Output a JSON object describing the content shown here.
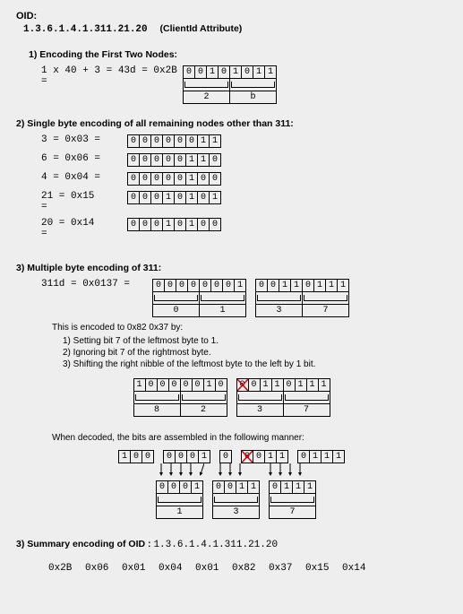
{
  "title": "OID:",
  "oid_value": "1.3.6.1.4.1.311.21.20",
  "oid_attr": "(ClientId Attribute)",
  "s1": {
    "heading": "1) Encoding the First Two Nodes:",
    "expr": "1 x 40 + 3 = 43d = 0x2B =",
    "bits": [
      "0",
      "0",
      "1",
      "0",
      "1",
      "0",
      "1",
      "1"
    ],
    "nibble_labels": [
      "2",
      "b"
    ]
  },
  "s2": {
    "heading": "2) Single byte encoding of all remaining nodes other than 311:",
    "rows": [
      {
        "lhs": "3  = 0x03 =",
        "bits": [
          "0",
          "0",
          "0",
          "0",
          "0",
          "0",
          "1",
          "1"
        ]
      },
      {
        "lhs": "6  = 0x06 =",
        "bits": [
          "0",
          "0",
          "0",
          "0",
          "0",
          "1",
          "1",
          "0"
        ]
      },
      {
        "lhs": "4  = 0x04 =",
        "bits": [
          "0",
          "0",
          "0",
          "0",
          "0",
          "1",
          "0",
          "0"
        ]
      },
      {
        "lhs": "21 = 0x15\n=",
        "bits": [
          "0",
          "0",
          "0",
          "1",
          "0",
          "1",
          "0",
          "1"
        ]
      },
      {
        "lhs": "20 = 0x14\n=",
        "bits": [
          "0",
          "0",
          "0",
          "1",
          "0",
          "1",
          "0",
          "0"
        ]
      }
    ]
  },
  "s3a": {
    "heading": "3) Multiple byte encoding of 311:",
    "lhs": "311d = 0x0137 =",
    "byte1": [
      "0",
      "0",
      "0",
      "0",
      "0",
      "0",
      "0",
      "1"
    ],
    "byte2": [
      "0",
      "0",
      "1",
      "1",
      "0",
      "1",
      "1",
      "1"
    ],
    "nibble_labels": [
      "0",
      "1",
      "3",
      "7"
    ],
    "intro": "This is encoded to 0x82 0x37 by:",
    "step1": "1) Setting bit 7 of the leftmost byte to 1.",
    "step2": "2) Ignoring bit 7 of the rightmost byte.",
    "step3": "3) Shifting the right nibble of the leftmost byte to the left by 1 bit.",
    "enc_byte1": [
      "1",
      "0",
      "0",
      "0",
      "0",
      "0",
      "1",
      "0"
    ],
    "enc_byte2_x": "0",
    "enc_byte2_rest": [
      "0",
      "1",
      "1",
      "0",
      "1",
      "1",
      "1"
    ],
    "enc_labels": [
      "8",
      "2",
      "3",
      "7"
    ],
    "decode_intro": "When decoded, the bits are assembled in the following manner:",
    "dec_top_a": [
      "1",
      "0",
      "0"
    ],
    "dec_top_b": [
      "0",
      "0",
      "0",
      "1"
    ],
    "dec_top_b2": [
      "0"
    ],
    "dec_top_c_x": "0",
    "dec_top_c": [
      "0",
      "1",
      "1"
    ],
    "dec_top_d": [
      "0",
      "1",
      "1",
      "1"
    ],
    "dec_bot_b": [
      "0",
      "0",
      "0",
      "1"
    ],
    "dec_bot_c": [
      "0",
      "0",
      "1",
      "1"
    ],
    "dec_bot_d": [
      "0",
      "1",
      "1",
      "1"
    ],
    "dec_labels": [
      "1",
      "3",
      "7"
    ]
  },
  "s4": {
    "heading": "3) Summary encoding of OID :",
    "oid_repeat": "1.3.6.1.4.1.311.21.20",
    "hex": "0x2B  0x06  0x01  0x04  0x01  0x82  0x37  0x15  0x14"
  }
}
